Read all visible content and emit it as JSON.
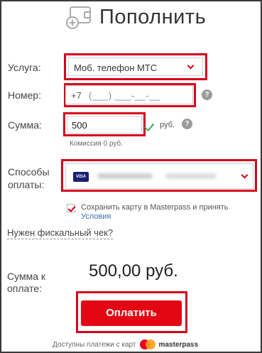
{
  "header": {
    "title": "Пополнить",
    "icon": "wallet-add-icon"
  },
  "form": {
    "service_label": "Услуга:",
    "service_value": "Моб. телефон МТС",
    "phone_label": "Номер:",
    "phone_prefix": "+7",
    "phone_mask": "(___) ___-__-__",
    "sum_label": "Сумма:",
    "sum_value": "500",
    "currency": "руб.",
    "commission": "Комиссия 0 руб.",
    "payment_methods_label": "Способы оплаты:",
    "card_brand": "VISA",
    "save_card_text": "Сохранить карту в Masterpass и принять",
    "terms_link": "Условия",
    "save_card_checked": true,
    "fiscal_receipt_link": "Нужен фискальный чек?",
    "help_glyph": "?"
  },
  "total": {
    "label": "Сумма к оплате:",
    "amount": "500,00 руб."
  },
  "actions": {
    "pay_button": "Оплатить"
  },
  "footer": {
    "text": "Доступны платежи с карт",
    "brand": "masterpass"
  },
  "colors": {
    "accent": "#e30613",
    "highlight_box": "#d6001c",
    "valid_check": "#3aa655",
    "link": "#3a6fb5"
  }
}
